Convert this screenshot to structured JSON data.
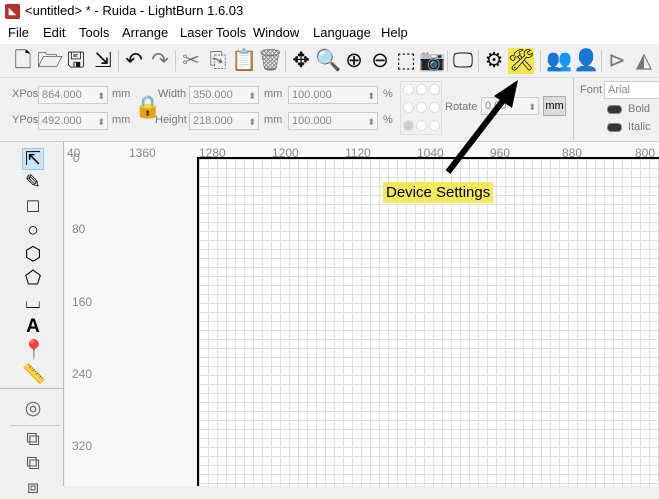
{
  "window": {
    "title": "<untitled> * - Ruida - LightBurn 1.6.03"
  },
  "menu": [
    "File",
    "Edit",
    "Tools",
    "Arrange",
    "Laser Tools",
    "Window",
    "Language",
    "Help"
  ],
  "edit": {
    "xpos_label": "XPos",
    "xpos": "864.000",
    "ypos_label": "YPos",
    "ypos": "492.000",
    "width_label": "Width",
    "width": "350.000",
    "height_label": "Height",
    "height": "218.000",
    "unit": "mm",
    "scale_w": "100.000",
    "scale_h": "100.000",
    "percent": "%",
    "rotate_label": "Rotate",
    "rotate": "0.00",
    "mm_button": "mm",
    "font_label": "Font",
    "font": "Arial",
    "bold": "Bold",
    "italic": "Italic"
  },
  "ruler": {
    "top": [
      "40",
      "1360",
      "1280",
      "1200",
      "1120",
      "1040",
      "960",
      "880",
      "800"
    ],
    "left": [
      "0",
      "80",
      "160",
      "240",
      "320"
    ]
  },
  "annotation": "Device Settings",
  "colors": {
    "highlight": "#f4e64a",
    "callout": "#f5e85a"
  }
}
